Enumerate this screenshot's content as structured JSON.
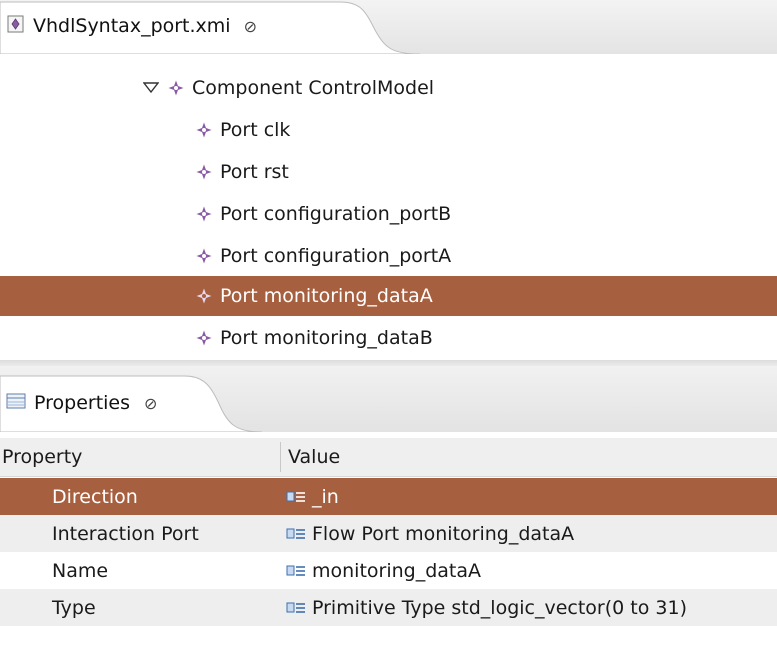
{
  "editor_tab": {
    "title": "VhdlSyntax_port.xmi",
    "close_glyph": "⊘"
  },
  "tree": {
    "component": {
      "label": "Component ControlModel",
      "expanded": true
    },
    "ports": [
      {
        "label": "Port clk",
        "selected": false
      },
      {
        "label": "Port rst",
        "selected": false
      },
      {
        "label": "Port configuration_portB",
        "selected": false
      },
      {
        "label": "Port configuration_portA",
        "selected": false
      },
      {
        "label": "Port monitoring_dataA",
        "selected": true
      },
      {
        "label": "Port monitoring_dataB",
        "selected": false
      }
    ]
  },
  "properties_tab": {
    "title": "Properties",
    "close_glyph": "⊘"
  },
  "properties_table": {
    "headers": [
      "Property",
      "Value"
    ],
    "rows": [
      {
        "property": "Direction",
        "value": "_in",
        "selected": true
      },
      {
        "property": "Interaction Port",
        "value": "Flow Port monitoring_dataA",
        "selected": false
      },
      {
        "property": "Name",
        "value": "monitoring_dataA",
        "selected": false
      },
      {
        "property": "Type",
        "value": "Primitive Type std_logic_vector(0 to 31)",
        "selected": false
      }
    ]
  },
  "colors": {
    "selection": "#a7603f",
    "icon_purple": "#8a5aa6"
  }
}
